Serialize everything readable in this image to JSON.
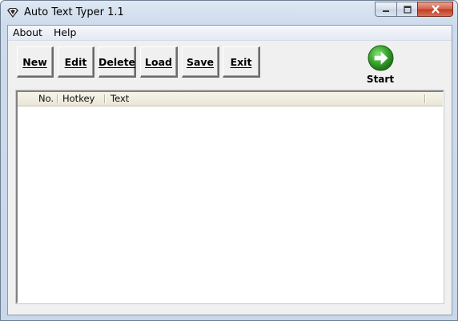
{
  "window": {
    "title": "Auto Text Typer 1.1",
    "controls": {
      "minimize": "minimize-icon",
      "maximize": "maximize-icon",
      "close": "close-icon"
    }
  },
  "menu": {
    "items": [
      {
        "label": "About"
      },
      {
        "label": "Help"
      }
    ]
  },
  "toolbar": {
    "buttons": [
      {
        "label": "New"
      },
      {
        "label": "Edit"
      },
      {
        "label": "Delete"
      },
      {
        "label": "Load"
      },
      {
        "label": "Save"
      },
      {
        "label": "Exit"
      }
    ],
    "start": {
      "label": "Start",
      "icon": "arrow-right-circle-icon",
      "color": "#3aa82e"
    }
  },
  "list": {
    "columns": [
      {
        "label": "No."
      },
      {
        "label": "Hotkey"
      },
      {
        "label": "Text"
      }
    ],
    "rows": []
  }
}
